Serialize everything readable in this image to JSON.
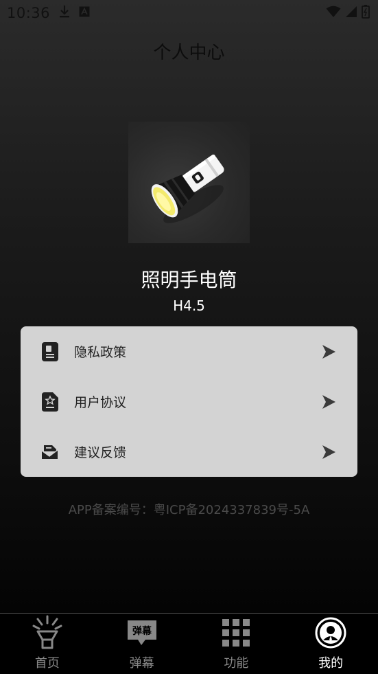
{
  "status_bar": {
    "time": "10:36",
    "icons": [
      "download-icon",
      "a-badge-icon",
      "wifi-icon",
      "signal-icon",
      "battery-icon"
    ]
  },
  "header": {
    "title": "个人中心"
  },
  "app": {
    "logo_icon": "flashlight-logo-icon",
    "name": "照明手电筒",
    "version": "H4.5"
  },
  "menu": {
    "items": [
      {
        "label": "隐私政策",
        "icon": "privacy-document-icon"
      },
      {
        "label": "用户协议",
        "icon": "user-agreement-icon"
      },
      {
        "label": "建议反馈",
        "icon": "feedback-mail-icon"
      }
    ],
    "arrow_icon": "chevron-right-icon"
  },
  "footer": {
    "icp": "APP备案编号：粤ICP备2024337839号-5A"
  },
  "tab_bar": {
    "tabs": [
      {
        "label": "首页",
        "icon": "flashlight-icon",
        "active": false
      },
      {
        "label": "弹幕",
        "icon": "danmaku-icon",
        "icon_text": "弹幕",
        "active": false
      },
      {
        "label": "功能",
        "icon": "grid-icon",
        "active": false
      },
      {
        "label": "我的",
        "icon": "profile-icon",
        "active": true
      }
    ]
  },
  "colors": {
    "menu_card_bg": "#d3d3d3",
    "accent_yellow": "#f3ea6c",
    "tab_active": "#ffffff",
    "tab_inactive": "#888888"
  }
}
